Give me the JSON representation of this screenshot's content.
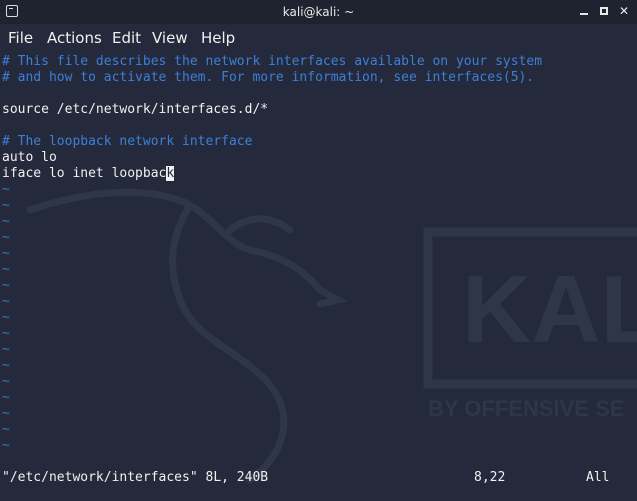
{
  "window": {
    "title": "kali@kali: ~",
    "icon": "terminal-icon",
    "controls": [
      "minimize-icon",
      "maximize-icon",
      "close-icon"
    ]
  },
  "menubar": {
    "items": [
      "File",
      "Actions",
      "Edit",
      "View",
      "Help"
    ]
  },
  "editor": {
    "lines": [
      "# This file describes the network interfaces available on your system",
      "# and how to activate them. For more information, see interfaces(5).",
      "",
      "source /etc/network/interfaces.d/*",
      "",
      "# The loopback network interface",
      "auto lo",
      "iface lo inet loopback"
    ],
    "empty_marker": "~",
    "empty_line_count": 17,
    "cursor_line_prefix": "iface lo inet loopbac",
    "cursor_char": "k"
  },
  "status": {
    "file_info": "\"/etc/network/interfaces\" 8L, 240B",
    "position": "8,22",
    "scroll": "All"
  },
  "watermark": {
    "brand": "KALI",
    "tagline": "BY OFFENSIVE SE"
  },
  "colors": {
    "background": "#242a3b",
    "comment": "#3d7fd7",
    "tilde": "#1d86b8",
    "text": "#f0f0f0"
  }
}
